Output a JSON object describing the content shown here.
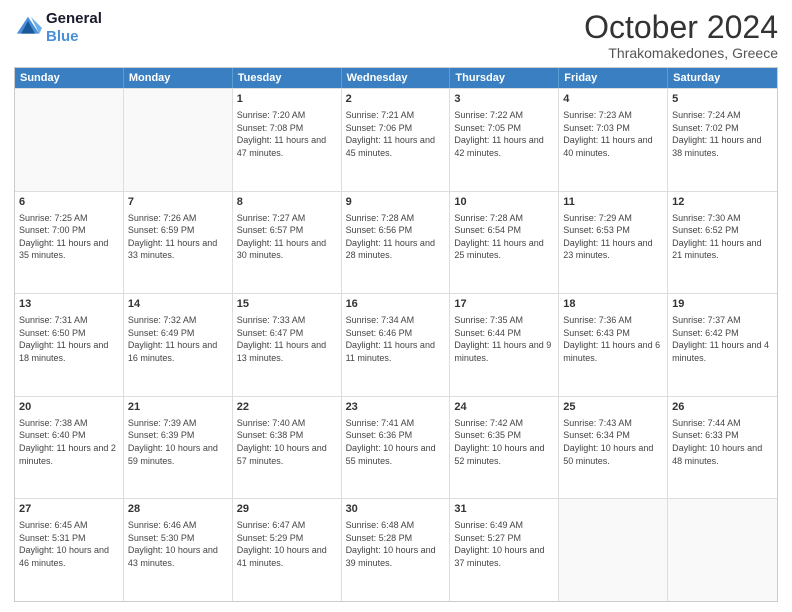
{
  "header": {
    "logo_line1": "General",
    "logo_line2": "Blue",
    "title": "October 2024",
    "subtitle": "Thrakomakedones, Greece"
  },
  "calendar": {
    "days": [
      "Sunday",
      "Monday",
      "Tuesday",
      "Wednesday",
      "Thursday",
      "Friday",
      "Saturday"
    ],
    "weeks": [
      [
        {
          "day": "",
          "info": ""
        },
        {
          "day": "",
          "info": ""
        },
        {
          "day": "1",
          "info": "Sunrise: 7:20 AM\nSunset: 7:08 PM\nDaylight: 11 hours and 47 minutes."
        },
        {
          "day": "2",
          "info": "Sunrise: 7:21 AM\nSunset: 7:06 PM\nDaylight: 11 hours and 45 minutes."
        },
        {
          "day": "3",
          "info": "Sunrise: 7:22 AM\nSunset: 7:05 PM\nDaylight: 11 hours and 42 minutes."
        },
        {
          "day": "4",
          "info": "Sunrise: 7:23 AM\nSunset: 7:03 PM\nDaylight: 11 hours and 40 minutes."
        },
        {
          "day": "5",
          "info": "Sunrise: 7:24 AM\nSunset: 7:02 PM\nDaylight: 11 hours and 38 minutes."
        }
      ],
      [
        {
          "day": "6",
          "info": "Sunrise: 7:25 AM\nSunset: 7:00 PM\nDaylight: 11 hours and 35 minutes."
        },
        {
          "day": "7",
          "info": "Sunrise: 7:26 AM\nSunset: 6:59 PM\nDaylight: 11 hours and 33 minutes."
        },
        {
          "day": "8",
          "info": "Sunrise: 7:27 AM\nSunset: 6:57 PM\nDaylight: 11 hours and 30 minutes."
        },
        {
          "day": "9",
          "info": "Sunrise: 7:28 AM\nSunset: 6:56 PM\nDaylight: 11 hours and 28 minutes."
        },
        {
          "day": "10",
          "info": "Sunrise: 7:28 AM\nSunset: 6:54 PM\nDaylight: 11 hours and 25 minutes."
        },
        {
          "day": "11",
          "info": "Sunrise: 7:29 AM\nSunset: 6:53 PM\nDaylight: 11 hours and 23 minutes."
        },
        {
          "day": "12",
          "info": "Sunrise: 7:30 AM\nSunset: 6:52 PM\nDaylight: 11 hours and 21 minutes."
        }
      ],
      [
        {
          "day": "13",
          "info": "Sunrise: 7:31 AM\nSunset: 6:50 PM\nDaylight: 11 hours and 18 minutes."
        },
        {
          "day": "14",
          "info": "Sunrise: 7:32 AM\nSunset: 6:49 PM\nDaylight: 11 hours and 16 minutes."
        },
        {
          "day": "15",
          "info": "Sunrise: 7:33 AM\nSunset: 6:47 PM\nDaylight: 11 hours and 13 minutes."
        },
        {
          "day": "16",
          "info": "Sunrise: 7:34 AM\nSunset: 6:46 PM\nDaylight: 11 hours and 11 minutes."
        },
        {
          "day": "17",
          "info": "Sunrise: 7:35 AM\nSunset: 6:44 PM\nDaylight: 11 hours and 9 minutes."
        },
        {
          "day": "18",
          "info": "Sunrise: 7:36 AM\nSunset: 6:43 PM\nDaylight: 11 hours and 6 minutes."
        },
        {
          "day": "19",
          "info": "Sunrise: 7:37 AM\nSunset: 6:42 PM\nDaylight: 11 hours and 4 minutes."
        }
      ],
      [
        {
          "day": "20",
          "info": "Sunrise: 7:38 AM\nSunset: 6:40 PM\nDaylight: 11 hours and 2 minutes."
        },
        {
          "day": "21",
          "info": "Sunrise: 7:39 AM\nSunset: 6:39 PM\nDaylight: 10 hours and 59 minutes."
        },
        {
          "day": "22",
          "info": "Sunrise: 7:40 AM\nSunset: 6:38 PM\nDaylight: 10 hours and 57 minutes."
        },
        {
          "day": "23",
          "info": "Sunrise: 7:41 AM\nSunset: 6:36 PM\nDaylight: 10 hours and 55 minutes."
        },
        {
          "day": "24",
          "info": "Sunrise: 7:42 AM\nSunset: 6:35 PM\nDaylight: 10 hours and 52 minutes."
        },
        {
          "day": "25",
          "info": "Sunrise: 7:43 AM\nSunset: 6:34 PM\nDaylight: 10 hours and 50 minutes."
        },
        {
          "day": "26",
          "info": "Sunrise: 7:44 AM\nSunset: 6:33 PM\nDaylight: 10 hours and 48 minutes."
        }
      ],
      [
        {
          "day": "27",
          "info": "Sunrise: 6:45 AM\nSunset: 5:31 PM\nDaylight: 10 hours and 46 minutes."
        },
        {
          "day": "28",
          "info": "Sunrise: 6:46 AM\nSunset: 5:30 PM\nDaylight: 10 hours and 43 minutes."
        },
        {
          "day": "29",
          "info": "Sunrise: 6:47 AM\nSunset: 5:29 PM\nDaylight: 10 hours and 41 minutes."
        },
        {
          "day": "30",
          "info": "Sunrise: 6:48 AM\nSunset: 5:28 PM\nDaylight: 10 hours and 39 minutes."
        },
        {
          "day": "31",
          "info": "Sunrise: 6:49 AM\nSunset: 5:27 PM\nDaylight: 10 hours and 37 minutes."
        },
        {
          "day": "",
          "info": ""
        },
        {
          "day": "",
          "info": ""
        }
      ]
    ]
  }
}
